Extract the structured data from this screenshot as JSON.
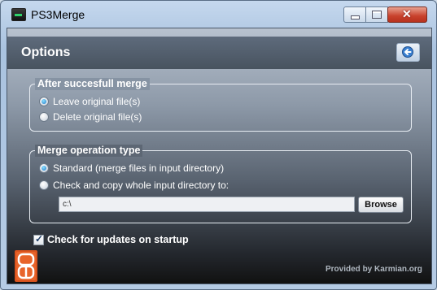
{
  "window": {
    "title": "PS3Merge",
    "icon": "ps3merge-app-icon"
  },
  "titlebar_buttons": {
    "minimize": "minimize-icon",
    "maximize": "maximize-icon",
    "close": "✕"
  },
  "header": {
    "title": "Options",
    "back_icon": "back-arrow-icon"
  },
  "after_merge": {
    "legend": "After succesfull merge",
    "options": [
      {
        "label": "Leave original file(s)",
        "checked": true
      },
      {
        "label": "Delete original file(s)",
        "checked": false
      }
    ]
  },
  "merge_type": {
    "legend": "Merge operation type",
    "options": [
      {
        "label": "Standard (merge files in input directory)",
        "checked": true
      },
      {
        "label": "Check and copy whole input directory to:",
        "checked": false
      }
    ],
    "path_value": "c:\\",
    "browse_label": "Browse"
  },
  "updates": {
    "label": "Check for updates on startup",
    "checked": true
  },
  "footer": {
    "provided_by": "Provided by Karmian.org",
    "logo_icon": "karmian-logo-icon"
  },
  "colors": {
    "close_button": "#c8412c",
    "radio_selected": "#1f78c8",
    "logo": "#d9531e"
  }
}
